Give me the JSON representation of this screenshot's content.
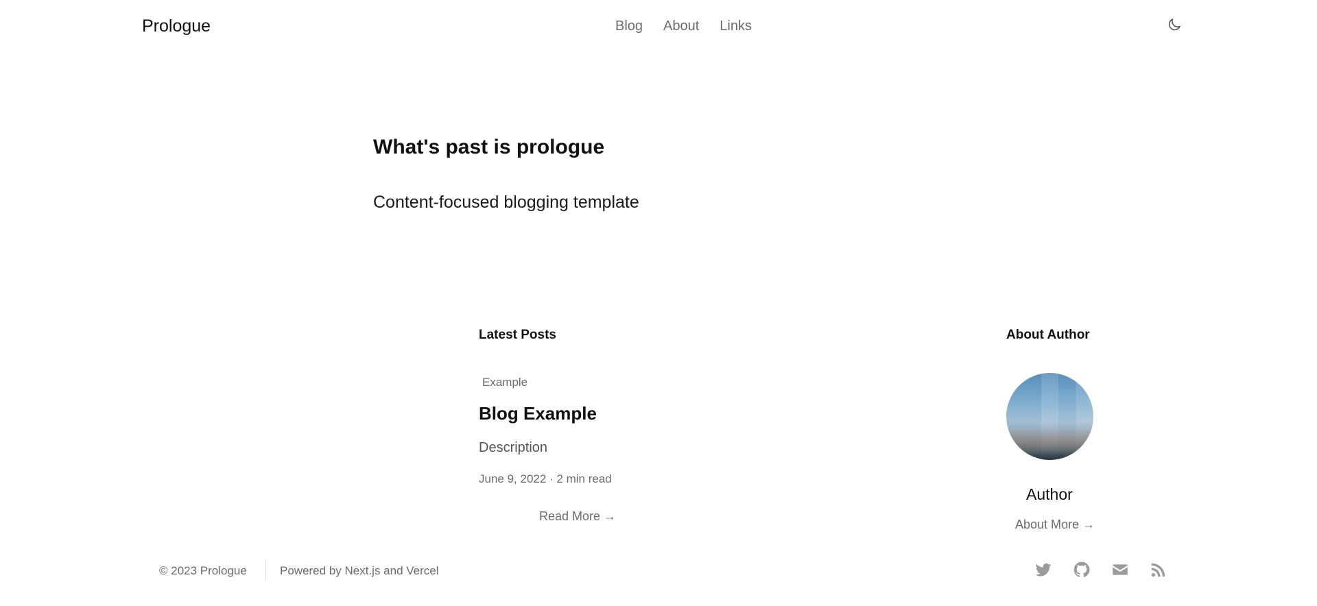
{
  "header": {
    "brand": "Prologue",
    "nav": [
      {
        "label": "Blog"
      },
      {
        "label": "About"
      },
      {
        "label": "Links"
      }
    ],
    "theme_toggle_icon": "moon-icon"
  },
  "hero": {
    "title": "What's past is prologue",
    "subtitle": "Content-focused blogging template"
  },
  "latest": {
    "section_title": "Latest Posts",
    "post": {
      "tag": "Example",
      "title": "Blog Example",
      "description": "Description",
      "meta": "June 9, 2022 · 2 min read",
      "read_more": "Read More →"
    }
  },
  "about": {
    "section_title": "About Author",
    "name": "Author",
    "more": "About More →"
  },
  "footer": {
    "copyright": "© 2023 Prologue",
    "powered": "Powered by Next.js and Vercel",
    "social_icons": [
      "twitter-icon",
      "github-icon",
      "mail-icon",
      "rss-icon"
    ]
  },
  "colors": {
    "text_primary": "#111111",
    "text_muted": "#6b6b6b",
    "icon": "#9b9b9b"
  }
}
